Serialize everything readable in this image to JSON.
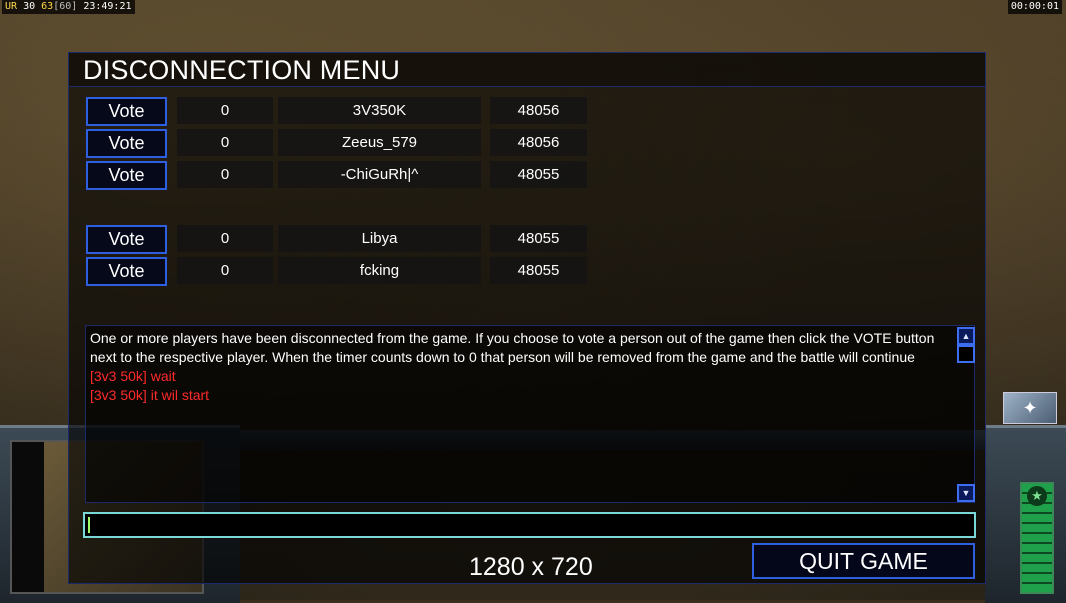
{
  "status": {
    "ur_label": "UR",
    "value1": "30",
    "value2": "63",
    "value3": "[60]",
    "clock": "23:49:21",
    "game_timer": "00:00:01"
  },
  "dialog": {
    "title": "DISCONNECTION MENU",
    "vote_label": "Vote",
    "players": [
      {
        "votes": "0",
        "name": "3V350K",
        "ping": "48056"
      },
      {
        "votes": "0",
        "name": "Zeeus_579",
        "ping": "48056"
      },
      {
        "votes": "0",
        "name": "-ChiGuRh|^",
        "ping": "48055"
      },
      {
        "votes": "0",
        "name": "Libya",
        "ping": "48055"
      },
      {
        "votes": "0",
        "name": "fcking",
        "ping": "48055"
      }
    ],
    "message": "One or more players have been disconnected from the game. If you choose to vote a person out of the game then click the VOTE button next to the respective player. When the timer counts down to 0 that person will be removed from the game and the battle will continue",
    "chat_lines": [
      "[3v3 50k] wait",
      "[3v3 50k] it wil start"
    ],
    "chat_color": "#ff2a2a",
    "chat_input_value": "",
    "quit_label": "QUIT GAME",
    "resolution": "1280 x 720"
  },
  "icons": {
    "scroll_up": "scroll-up-icon",
    "scroll_down": "scroll-down-icon",
    "satellite": "satellite-icon",
    "power": "power-meter-icon"
  },
  "colors": {
    "button_border": "#2e5fe0",
    "input_border": "#7ad8d8"
  }
}
